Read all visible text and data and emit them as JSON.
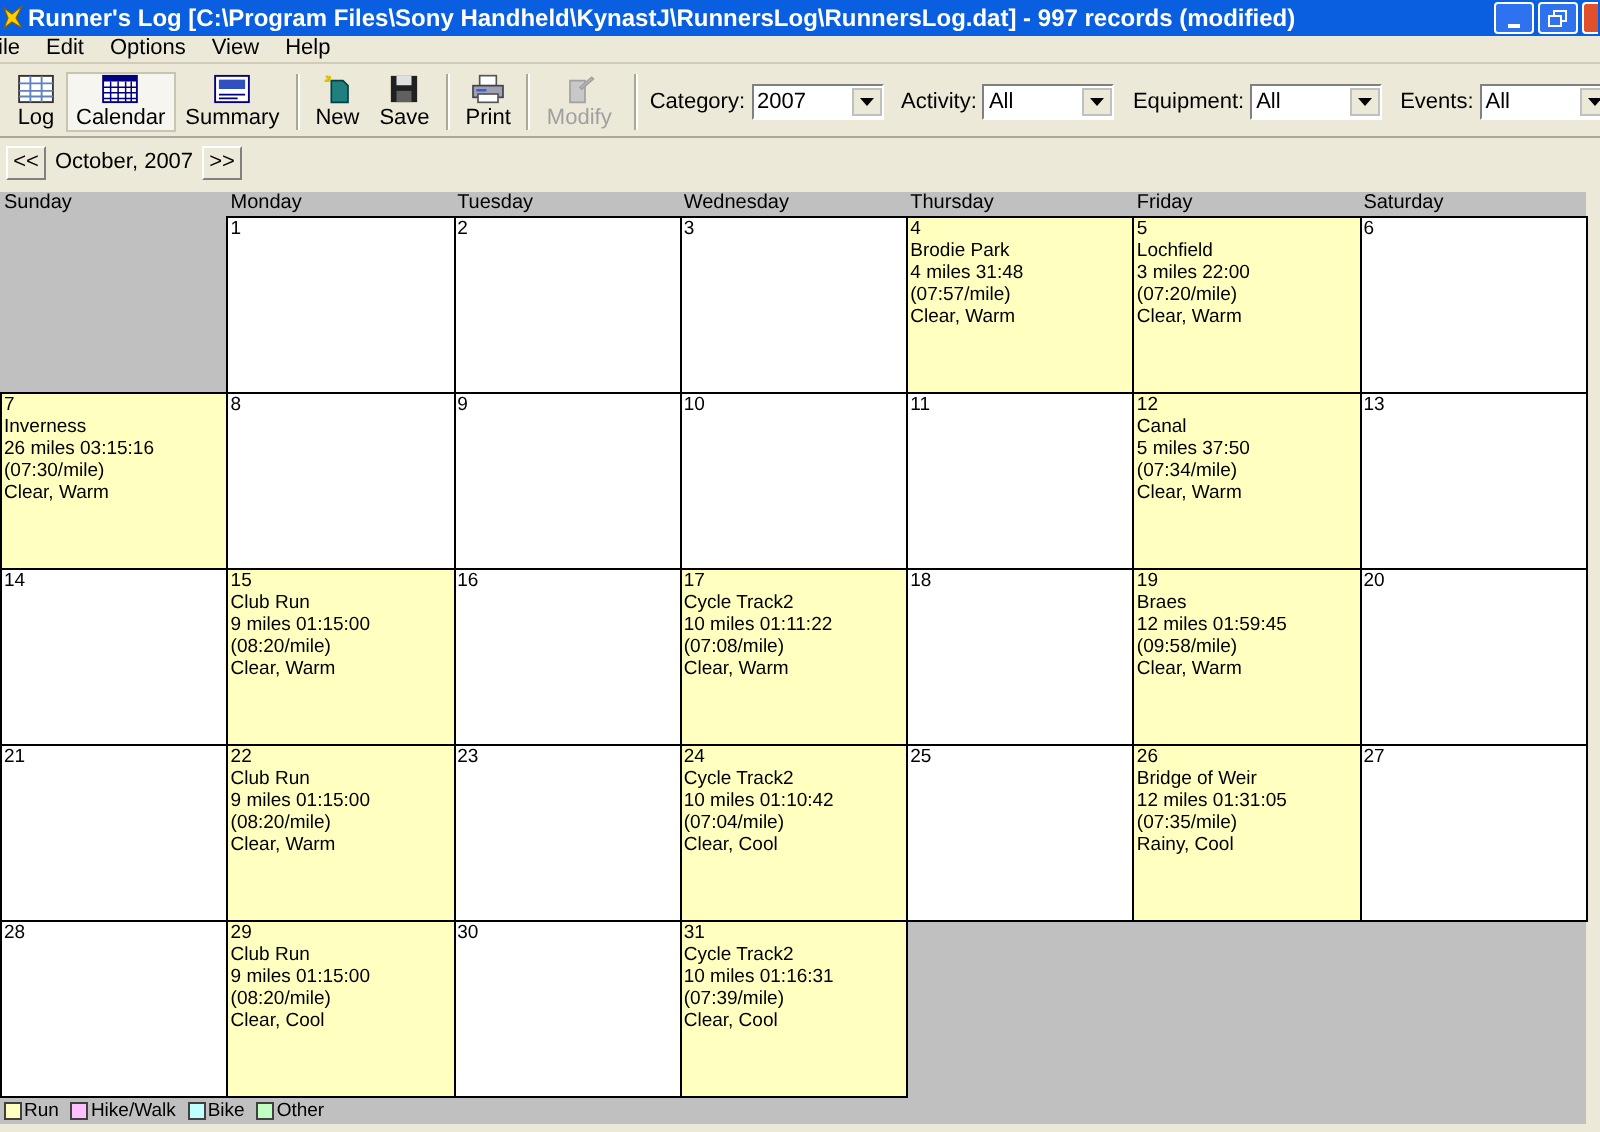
{
  "window": {
    "title": "Runner's Log [C:\\Program Files\\Sony Handheld\\KynastJ\\RunnersLog\\RunnersLog.dat] - 997 records (modified)"
  },
  "menu": [
    "ile",
    "Edit",
    "Options",
    "View",
    "Help"
  ],
  "toolbar": [
    {
      "label": "Log",
      "kind": "log",
      "selected": false,
      "disabled": false
    },
    {
      "label": "Calendar",
      "kind": "calendar",
      "selected": true,
      "disabled": false
    },
    {
      "label": "Summary",
      "kind": "summary",
      "selected": false,
      "disabled": false
    },
    {
      "label": "New",
      "kind": "new",
      "selected": false,
      "disabled": false
    },
    {
      "label": "Save",
      "kind": "save",
      "selected": false,
      "disabled": false
    },
    {
      "label": "Print",
      "kind": "print",
      "selected": false,
      "disabled": false
    },
    {
      "label": "Modify",
      "kind": "modify",
      "selected": false,
      "disabled": true
    }
  ],
  "filters": [
    {
      "label": "Category:",
      "value": "2007"
    },
    {
      "label": "Activity:",
      "value": "All"
    },
    {
      "label": "Equipment:",
      "value": "All"
    },
    {
      "label": "Events:",
      "value": "All"
    }
  ],
  "nav": {
    "prev": "<<",
    "month": "October, 2007",
    "next": ">>"
  },
  "weekdays": [
    "Sunday",
    "Monday",
    "Tuesday",
    "Wednesday",
    "Thursday",
    "Friday",
    "Saturday"
  ],
  "weeks": [
    [
      {
        "kind": "blank"
      },
      {
        "kind": "day",
        "day": "1"
      },
      {
        "kind": "day",
        "day": "2"
      },
      {
        "kind": "day",
        "day": "3"
      },
      {
        "kind": "day",
        "day": "4",
        "color": "#ffffc0",
        "lines": [
          "Brodie Park",
          "4 miles 31:48",
          "(07:57/mile)",
          "Clear, Warm"
        ]
      },
      {
        "kind": "day",
        "day": "5",
        "color": "#ffffc0",
        "lines": [
          "Lochfield",
          "3 miles 22:00",
          "(07:20/mile)",
          "Clear, Warm"
        ]
      },
      {
        "kind": "day",
        "day": "6"
      }
    ],
    [
      {
        "kind": "day",
        "day": "7",
        "color": "#ffffc0",
        "lines": [
          "Inverness",
          "26 miles 03:15:16",
          "(07:30/mile)",
          "Clear, Warm"
        ]
      },
      {
        "kind": "day",
        "day": "8"
      },
      {
        "kind": "day",
        "day": "9"
      },
      {
        "kind": "day",
        "day": "10"
      },
      {
        "kind": "day",
        "day": "11"
      },
      {
        "kind": "day",
        "day": "12",
        "color": "#ffffc0",
        "lines": [
          "Canal",
          "5 miles 37:50",
          "(07:34/mile)",
          "Clear, Warm"
        ]
      },
      {
        "kind": "day",
        "day": "13"
      }
    ],
    [
      {
        "kind": "day",
        "day": "14"
      },
      {
        "kind": "day",
        "day": "15",
        "color": "#ffffc0",
        "lines": [
          "Club Run",
          "9 miles 01:15:00",
          "(08:20/mile)",
          "Clear, Warm"
        ]
      },
      {
        "kind": "day",
        "day": "16"
      },
      {
        "kind": "day",
        "day": "17",
        "color": "#ffffc0",
        "lines": [
          "Cycle Track2",
          "10 miles 01:11:22",
          "(07:08/mile)",
          "Clear, Warm"
        ]
      },
      {
        "kind": "day",
        "day": "18"
      },
      {
        "kind": "day",
        "day": "19",
        "color": "#ffffc0",
        "lines": [
          "Braes",
          "12 miles 01:59:45",
          "(09:58/mile)",
          "Clear, Warm"
        ]
      },
      {
        "kind": "day",
        "day": "20"
      }
    ],
    [
      {
        "kind": "day",
        "day": "21"
      },
      {
        "kind": "day",
        "day": "22",
        "color": "#ffffc0",
        "lines": [
          "Club Run",
          "9 miles 01:15:00",
          "(08:20/mile)",
          "Clear, Warm"
        ]
      },
      {
        "kind": "day",
        "day": "23"
      },
      {
        "kind": "day",
        "day": "24",
        "color": "#ffffc0",
        "lines": [
          "Cycle Track2",
          "10 miles 01:10:42",
          "(07:04/mile)",
          "Clear, Cool"
        ]
      },
      {
        "kind": "day",
        "day": "25"
      },
      {
        "kind": "day",
        "day": "26",
        "color": "#ffffc0",
        "lines": [
          "Bridge of Weir",
          "12 miles 01:31:05",
          "(07:35/mile)",
          "Rainy, Cool"
        ]
      },
      {
        "kind": "day",
        "day": "27"
      }
    ],
    [
      {
        "kind": "day",
        "day": "28"
      },
      {
        "kind": "day",
        "day": "29",
        "color": "#ffffc0",
        "lines": [
          "Club Run",
          "9 miles 01:15:00",
          "(08:20/mile)",
          "Clear, Cool"
        ]
      },
      {
        "kind": "day",
        "day": "30"
      },
      {
        "kind": "day",
        "day": "31",
        "color": "#ffffc0",
        "lines": [
          "Cycle Track2",
          "10 miles 01:16:31",
          "(07:39/mile)",
          "Clear, Cool"
        ]
      },
      {
        "kind": "blank"
      },
      {
        "kind": "blank"
      },
      {
        "kind": "blank"
      }
    ]
  ],
  "legend": [
    {
      "label": "Run",
      "color": "#ffffc0"
    },
    {
      "label": "Hike/Walk",
      "color": "#ffc0ff"
    },
    {
      "label": "Bike",
      "color": "#c0ffff"
    },
    {
      "label": "Other",
      "color": "#c0ffc0"
    }
  ]
}
